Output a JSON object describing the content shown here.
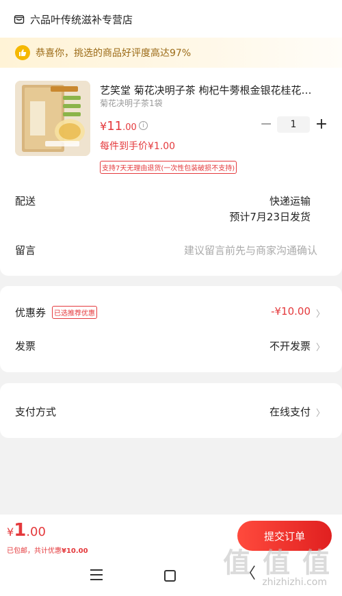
{
  "shop": {
    "name": "六品叶传统滋补专营店",
    "icon": "shop-icon"
  },
  "banner": {
    "text": "恭喜你，挑选的商品好评度高达97%",
    "icon": "thumbs-up-icon"
  },
  "product": {
    "title": "艺笑堂 菊花决明子茶 枸杞牛蒡根金银花桂花…",
    "spec": "菊花决明子茶1袋",
    "price_symbol": "¥",
    "price_int": "11",
    "price_dec": ".00",
    "unit_price": "每件到手价¥1.00",
    "return_policy": "支持7天无理由退货(一次性包装破损不支持)",
    "quantity": "1",
    "qty_minus": "−",
    "qty_plus": "+"
  },
  "shipping": {
    "label": "配送",
    "method": "快递运输",
    "estimate": "预计7月23日发货"
  },
  "note": {
    "label": "留言",
    "placeholder": "建议留言前先与商家沟通确认"
  },
  "coupon": {
    "label": "优惠券",
    "tag": "已选推荐优惠",
    "value": "-¥10.00"
  },
  "invoice": {
    "label": "发票",
    "value": "不开发票"
  },
  "payment": {
    "label": "支付方式",
    "value": "在线支付"
  },
  "footer": {
    "total_symbol": "¥",
    "total_int": "1",
    "total_dec": ".00",
    "shipping_note": "已包邮，共计优惠",
    "saved_amount": "¥10.00",
    "submit_label": "提交订单"
  },
  "watermark": {
    "text": "值 值 值",
    "url": "zhizhizhi.com"
  },
  "colors": {
    "accent": "#e4393c",
    "banner_text": "#9b6a16",
    "background": "#f2f2f2"
  }
}
